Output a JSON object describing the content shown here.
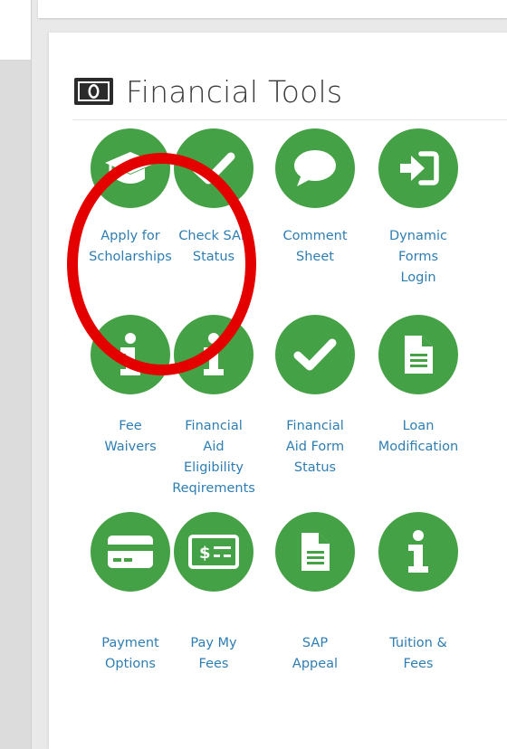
{
  "panel": {
    "title": "Financial Tools",
    "title_icon": "money-bill-icon"
  },
  "colors": {
    "accent_green": "#45a145",
    "link_blue": "#2e7eb3",
    "annotation_red": "#e50000"
  },
  "tools": [
    {
      "icon": "graduation-cap-icon",
      "label_lines": [
        "Apply for",
        "Scholarships"
      ]
    },
    {
      "icon": "check-icon",
      "label_lines": [
        "Check SAP",
        "Status"
      ]
    },
    {
      "icon": "comment-icon",
      "label_lines": [
        "Comment",
        "Sheet"
      ]
    },
    {
      "icon": "sign-in-icon",
      "label_lines": [
        "Dynamic",
        "Forms",
        "Login"
      ]
    },
    {
      "icon": "info-icon",
      "label_lines": [
        "Fee",
        "Waivers"
      ]
    },
    {
      "icon": "info-icon",
      "label_lines": [
        "Financial",
        "Aid",
        "Eligibility",
        "Reqirements"
      ]
    },
    {
      "icon": "check-icon",
      "label_lines": [
        "Financial",
        "Aid Form",
        "Status"
      ]
    },
    {
      "icon": "file-icon",
      "label_lines": [
        "Loan",
        "Modification"
      ]
    },
    {
      "icon": "credit-card-icon",
      "label_lines": [
        "Payment",
        "Options"
      ]
    },
    {
      "icon": "money-bill-icon",
      "label_lines": [
        "Pay My",
        "Fees"
      ]
    },
    {
      "icon": "file-icon",
      "label_lines": [
        "SAP",
        "Appeal"
      ]
    },
    {
      "icon": "info-icon",
      "label_lines": [
        "Tuition &",
        "Fees"
      ]
    }
  ]
}
